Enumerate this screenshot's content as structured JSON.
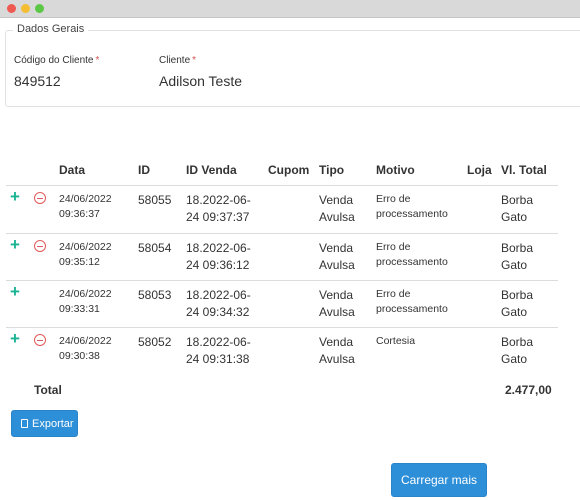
{
  "window": {
    "controls": [
      "close",
      "minimize",
      "maximize"
    ]
  },
  "dados_gerais": {
    "legend": "Dados Gerais",
    "codigo_label": "Código do Cliente",
    "codigo_value": "849512",
    "cliente_label": "Cliente",
    "cliente_value": "Adilson Teste",
    "required_mark": "*"
  },
  "table": {
    "headers": {
      "data": "Data",
      "id": "ID",
      "id_venda": "ID Venda",
      "cupom": "Cupom",
      "tipo": "Tipo",
      "motivo": "Motivo",
      "loja": "Loja",
      "vl_total": "Vl. Total"
    },
    "rows": [
      {
        "date": "24/06/2022",
        "time": "09:36:37",
        "id": "58055",
        "venda_line1": "18.2022-06-",
        "venda_line2": "24 09:37:37",
        "cupom": "",
        "tipo_line1": "Venda",
        "tipo_line2": "Avulsa",
        "motivo_line1": "Erro de",
        "motivo_line2": "processamento",
        "loja": "",
        "total_line1": "Borba",
        "total_line2": "Gato",
        "has_remove": true
      },
      {
        "date": "24/06/2022",
        "time": "09:35:12",
        "id": "58054",
        "venda_line1": "18.2022-06-",
        "venda_line2": "24 09:36:12",
        "cupom": "",
        "tipo_line1": "Venda",
        "tipo_line2": "Avulsa",
        "motivo_line1": "Erro de",
        "motivo_line2": "processamento",
        "loja": "",
        "total_line1": "Borba",
        "total_line2": "Gato",
        "has_remove": true
      },
      {
        "date": "24/06/2022",
        "time": "09:33:31",
        "id": "58053",
        "venda_line1": "18.2022-06-",
        "venda_line2": "24 09:34:32",
        "cupom": "",
        "tipo_line1": "Venda",
        "tipo_line2": "Avulsa",
        "motivo_line1": "Erro de",
        "motivo_line2": "processamento",
        "loja": "",
        "total_line1": "Borba",
        "total_line2": "Gato",
        "has_remove": false
      },
      {
        "date": "24/06/2022",
        "time": "09:30:38",
        "id": "58052",
        "venda_line1": "18.2022-06-",
        "venda_line2": "24 09:31:38",
        "cupom": "",
        "tipo_line1": "Venda",
        "tipo_line2": "Avulsa",
        "motivo_line1": "Cortesia",
        "motivo_line2": "",
        "loja": "",
        "total_line1": "Borba",
        "total_line2": "Gato",
        "has_remove": true
      }
    ],
    "total_label": "Total",
    "total_value": "2.477,00"
  },
  "buttons": {
    "export_label": "Exportar",
    "load_more_label": "Carregar mais"
  },
  "icons": {
    "add": "plus-icon",
    "remove": "minus-circle-icon",
    "export": "file-icon"
  },
  "colors": {
    "add_icon": "#1ab394",
    "remove_icon": "#e0595b",
    "button": "#2d8fd8",
    "required": "#d9534f"
  }
}
